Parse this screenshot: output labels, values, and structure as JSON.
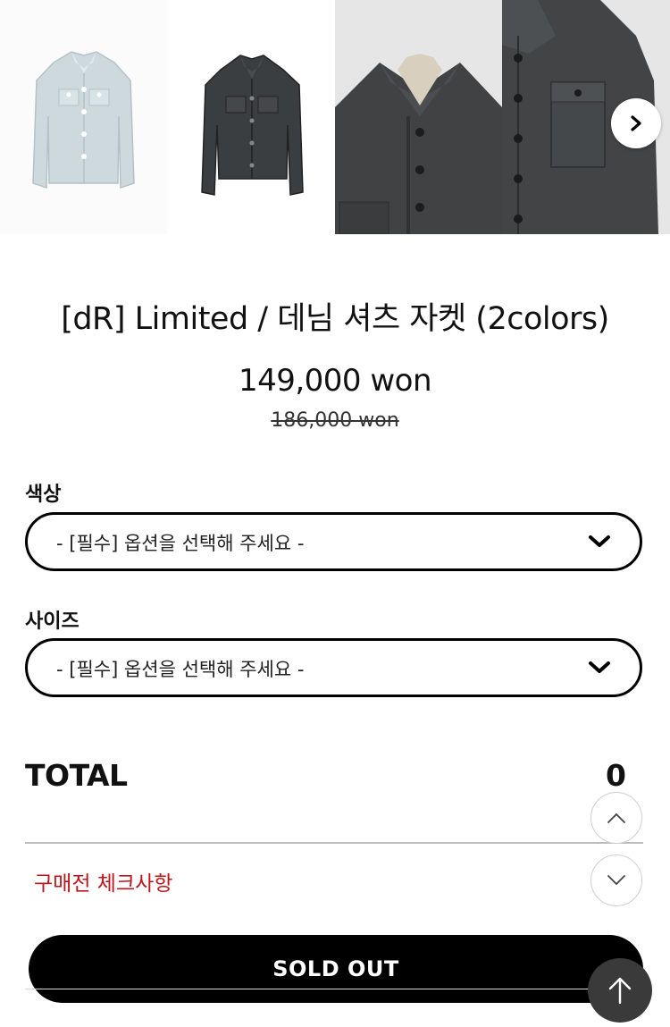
{
  "product": {
    "title": "[dR] Limited / 데님 셔츠 자켓 (2colors)",
    "price": "149,000 won",
    "original_price": "186,000 won"
  },
  "gallery": {
    "images": [
      "light-blue-jacket",
      "charcoal-jacket-front",
      "collar-detail",
      "pocket-detail"
    ],
    "next_icon": "chevron-right-icon"
  },
  "options": [
    {
      "label": "색상",
      "placeholder": "- [필수] 옵션을 선택해 주세요 -"
    },
    {
      "label": "사이즈",
      "placeholder": "- [필수] 옵션을 선택해 주세요 -"
    }
  ],
  "total": {
    "label": "TOTAL",
    "value": "0"
  },
  "checklist": {
    "label": "구매전 체크사항",
    "color": "#c0141b"
  },
  "buttons": {
    "sold_out": "SOLD OUT"
  },
  "fabs": {
    "up": "chevron-up-icon",
    "down": "chevron-down-icon",
    "scroll_top": "arrow-up-icon"
  }
}
